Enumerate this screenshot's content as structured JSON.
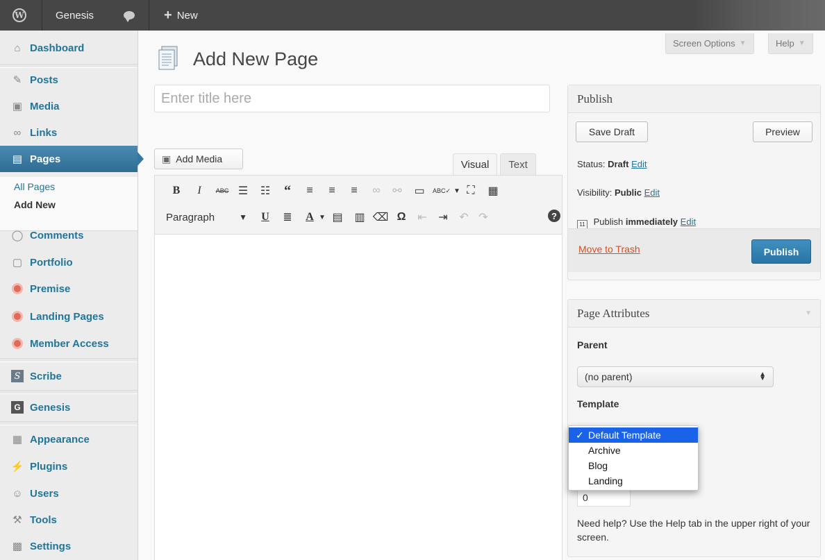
{
  "admin_bar": {
    "site_name": "Genesis",
    "new_label": "New"
  },
  "sidebar": {
    "items": [
      {
        "label": "Dashboard",
        "icon": "dashboard-icon"
      },
      {
        "label": "Posts",
        "icon": "pushpin-icon"
      },
      {
        "label": "Media",
        "icon": "media-icon"
      },
      {
        "label": "Links",
        "icon": "link-icon"
      },
      {
        "label": "Pages",
        "icon": "pages-icon"
      },
      {
        "label": "Comments",
        "icon": "comment-bubble-icon"
      },
      {
        "label": "Portfolio",
        "icon": "portfolio-icon"
      },
      {
        "label": "Premise",
        "icon": "premise-icon"
      },
      {
        "label": "Landing Pages",
        "icon": "landing-pages-icon"
      },
      {
        "label": "Member Access",
        "icon": "member-access-icon"
      },
      {
        "label": "Scribe",
        "icon": "scribe-icon"
      },
      {
        "label": "Genesis",
        "icon": "genesis-icon"
      },
      {
        "label": "Appearance",
        "icon": "appearance-icon"
      },
      {
        "label": "Plugins",
        "icon": "plugin-icon"
      },
      {
        "label": "Users",
        "icon": "users-icon"
      },
      {
        "label": "Tools",
        "icon": "tools-icon"
      },
      {
        "label": "Settings",
        "icon": "settings-icon"
      }
    ],
    "submenu": {
      "all_pages": "All Pages",
      "add_new": "Add New"
    },
    "active_color": "#3e7ea5",
    "genesis_letter": "G"
  },
  "header": {
    "title": "Add New Page",
    "screen_options": "Screen Options",
    "help": "Help"
  },
  "editor": {
    "title_placeholder": "Enter title here",
    "add_media": "Add Media",
    "tab_visual": "Visual",
    "tab_text": "Text",
    "format_select": "Paragraph"
  },
  "publish": {
    "heading": "Publish",
    "save_draft": "Save Draft",
    "preview": "Preview",
    "status_label": "Status:",
    "status_value": "Draft",
    "visibility_label": "Visibility:",
    "visibility_value": "Public",
    "publish_label": "Publish",
    "publish_when": "immediately",
    "edit": "Edit",
    "calendar_day": "11",
    "move_to_trash": "Move to Trash",
    "publish_button": "Publish",
    "accent_color": "#2a74a4",
    "trash_color": "#d54e21"
  },
  "page_attributes": {
    "heading": "Page Attributes",
    "parent_label": "Parent",
    "parent_value": "(no parent)",
    "template_label": "Template",
    "template_options": [
      "Default Template",
      "Archive",
      "Blog",
      "Landing"
    ],
    "template_selected_mark": "✓",
    "order_value": "0",
    "help_text": "Need help? Use the Help tab in the upper right of your screen."
  }
}
